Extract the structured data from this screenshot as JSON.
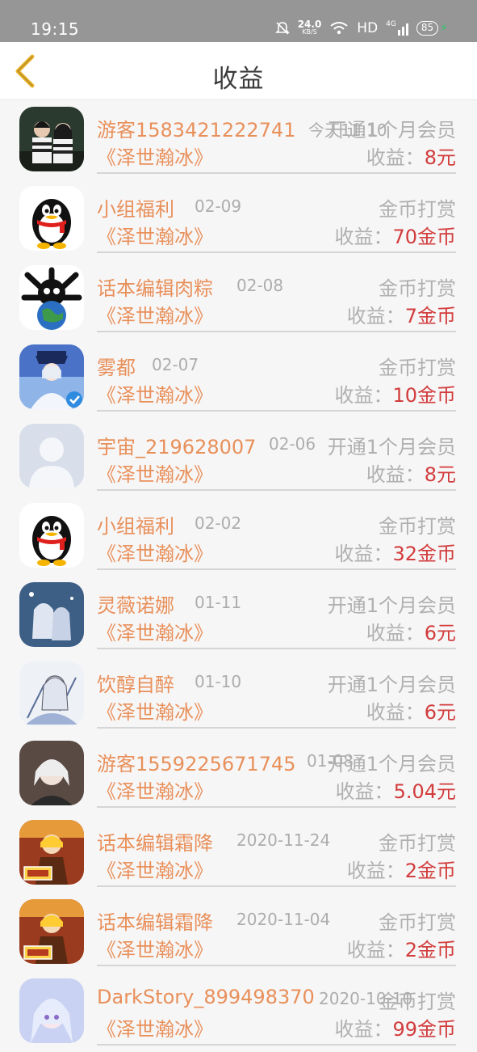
{
  "status_bar": {
    "time": "19:15",
    "speed": "24.0",
    "speed_unit": "KB/S",
    "network": "HD",
    "signal": "4G",
    "battery": "85"
  },
  "header": {
    "title": "收益"
  },
  "earn_label": "收益：",
  "rows": [
    {
      "name": "游客1583421222741",
      "date": "今天11:10",
      "type": "开通1个月会员",
      "book": "《泽世瀚冰》",
      "amount": "8元",
      "avatar": "couple-photo"
    },
    {
      "name": "小组福利",
      "date": "02-09",
      "type": "金币打赏",
      "book": "《泽世瀚冰》",
      "amount": "70金币",
      "avatar": "penguin"
    },
    {
      "name": "话本编辑肉粽",
      "date": "02-08",
      "type": "金币打赏",
      "book": "《泽世瀚冰》",
      "amount": "7金币",
      "avatar": "bone-earth"
    },
    {
      "name": "雾都",
      "date": "02-07",
      "type": "金币打赏",
      "book": "《泽世瀚冰》",
      "amount": "10金币",
      "avatar": "anime-blue"
    },
    {
      "name": "宇宙_219628007",
      "date": "02-06",
      "type": "开通1个月会员",
      "book": "《泽世瀚冰》",
      "amount": "8元",
      "avatar": "default-person"
    },
    {
      "name": "小组福利",
      "date": "02-02",
      "type": "金币打赏",
      "book": "《泽世瀚冰》",
      "amount": "32金币",
      "avatar": "penguin"
    },
    {
      "name": "灵薇诺娜",
      "date": "01-11",
      "type": "开通1个月会员",
      "book": "《泽世瀚冰》",
      "amount": "6元",
      "avatar": "anime-winter"
    },
    {
      "name": "饮醇自醉",
      "date": "01-10",
      "type": "开通1个月会员",
      "book": "《泽世瀚冰》",
      "amount": "6元",
      "avatar": "anime-sketch"
    },
    {
      "name": "游客1559225671745",
      "date": "01-08",
      "type": "开通1个月会员",
      "book": "《泽世瀚冰》",
      "amount": "5.04元",
      "avatar": "anime-grey"
    },
    {
      "name": "话本编辑霜降",
      "date": "2020-11-24",
      "type": "金币打赏",
      "book": "《泽世瀚冰》",
      "amount": "2金币",
      "avatar": "editor-badge"
    },
    {
      "name": "话本编辑霜降",
      "date": "2020-11-04",
      "type": "金币打赏",
      "book": "《泽世瀚冰》",
      "amount": "2金币",
      "avatar": "editor-badge"
    },
    {
      "name": "DarkStory_899498370",
      "date": "2020-10-10",
      "type": "金币打赏",
      "book": "《泽世瀚冰》",
      "amount": "99金币",
      "avatar": "anime-pastel"
    }
  ],
  "colors": {
    "accent": "#e8905a",
    "amount": "#d23c3c",
    "muted": "#b0b0b0",
    "status_bar": "#969696"
  }
}
